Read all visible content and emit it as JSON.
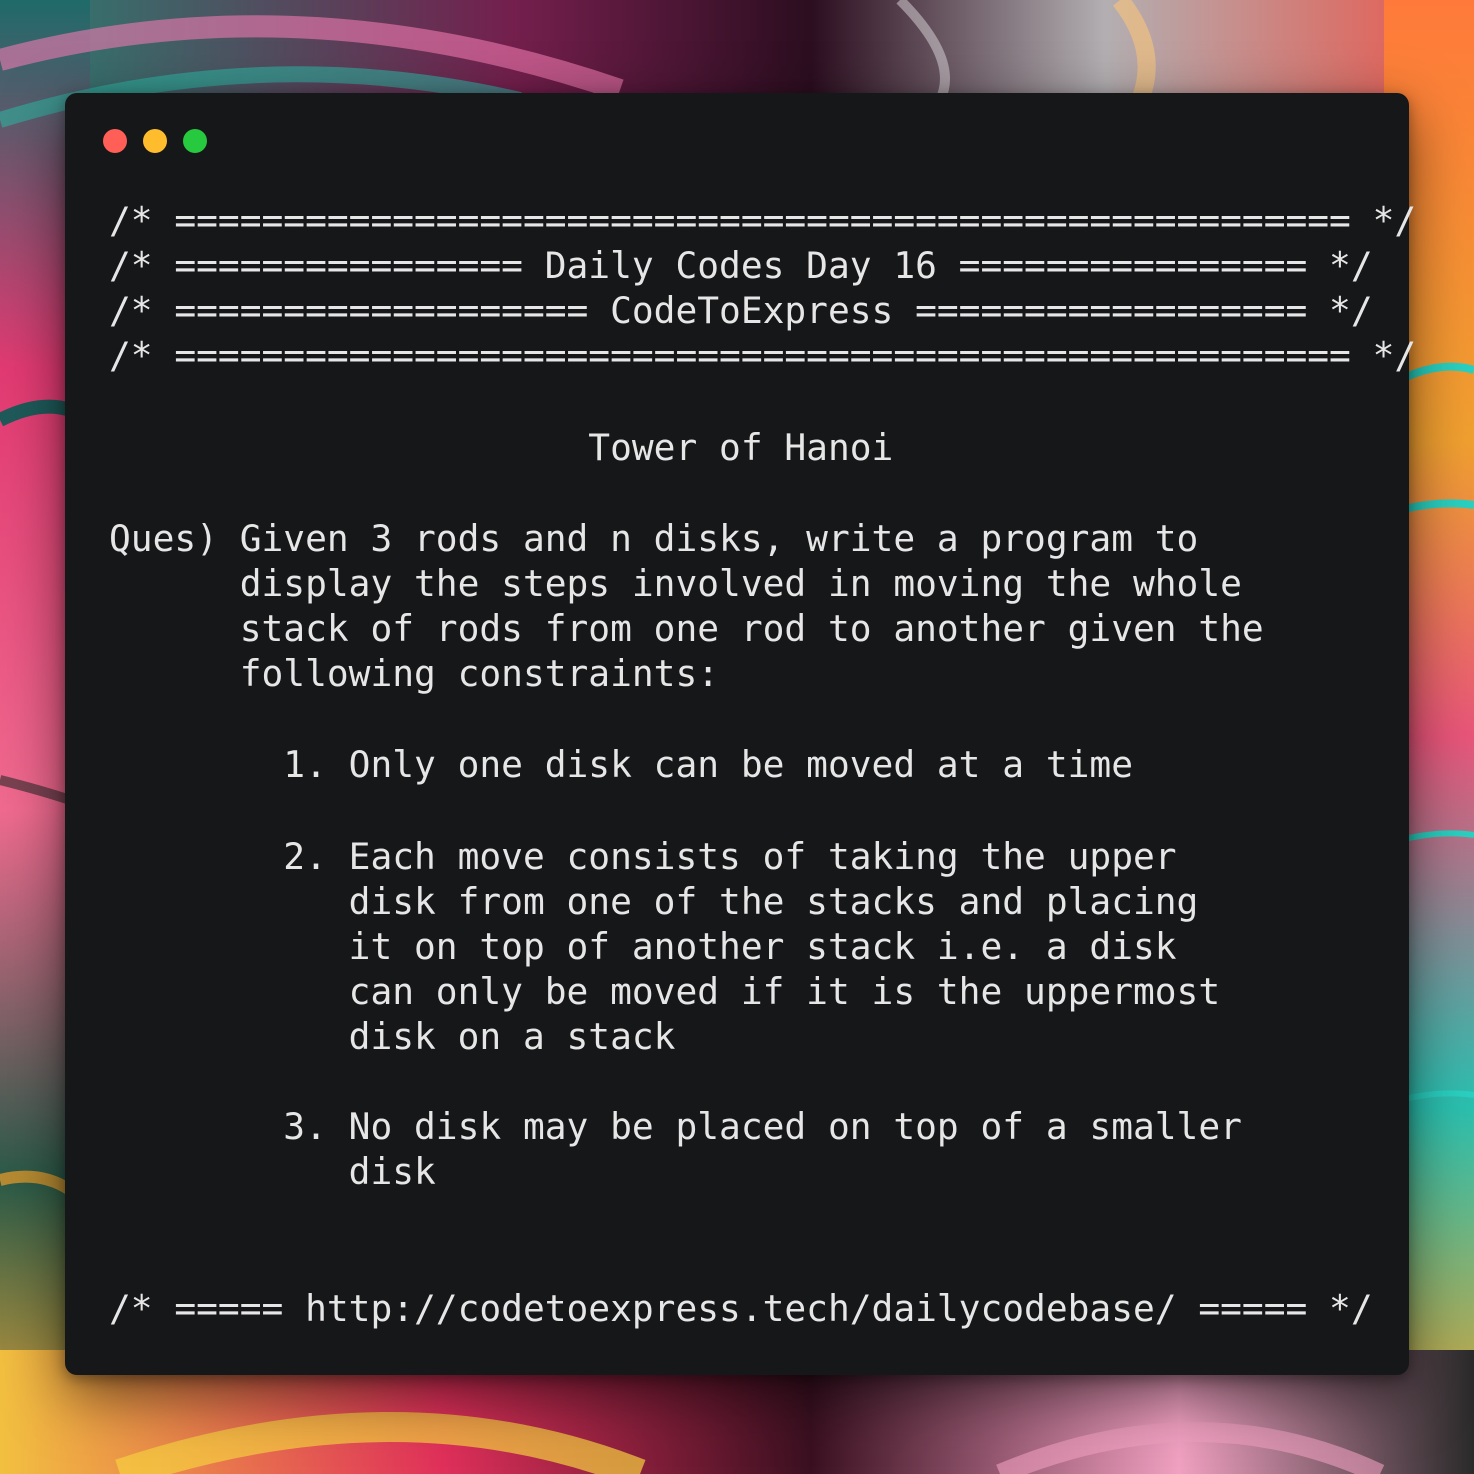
{
  "window": {
    "buttons": {
      "close_color": "#ff5f56",
      "minimize_color": "#ffbd2e",
      "maximize_color": "#27c93f"
    }
  },
  "header": {
    "line1": "/* ====================================================== */",
    "line2": "/* ================ Daily Codes Day 16 ================ */",
    "line3": "/* =================== CodeToExpress ================== */",
    "line4": "/* ====================================================== */"
  },
  "title": "                      Tower of Hanoi",
  "question": {
    "lines": [
      "Ques) Given 3 rods and n disks, write a program to",
      "      display the steps involved in moving the whole",
      "      stack of rods from one rod to another given the",
      "      following constraints:"
    ]
  },
  "constraints": {
    "item1": [
      "        1. Only one disk can be moved at a time"
    ],
    "item2": [
      "        2. Each move consists of taking the upper",
      "           disk from one of the stacks and placing",
      "           it on top of another stack i.e. a disk",
      "           can only be moved if it is the uppermost",
      "           disk on a stack"
    ],
    "item3": [
      "        3. No disk may be placed on top of a smaller",
      "           disk"
    ]
  },
  "footer": {
    "line": "/* ===== http://codetoexpress.tech/dailycodebase/ ===== */"
  },
  "colors": {
    "window_bg": "#161719",
    "text": "#e6e6e6"
  }
}
